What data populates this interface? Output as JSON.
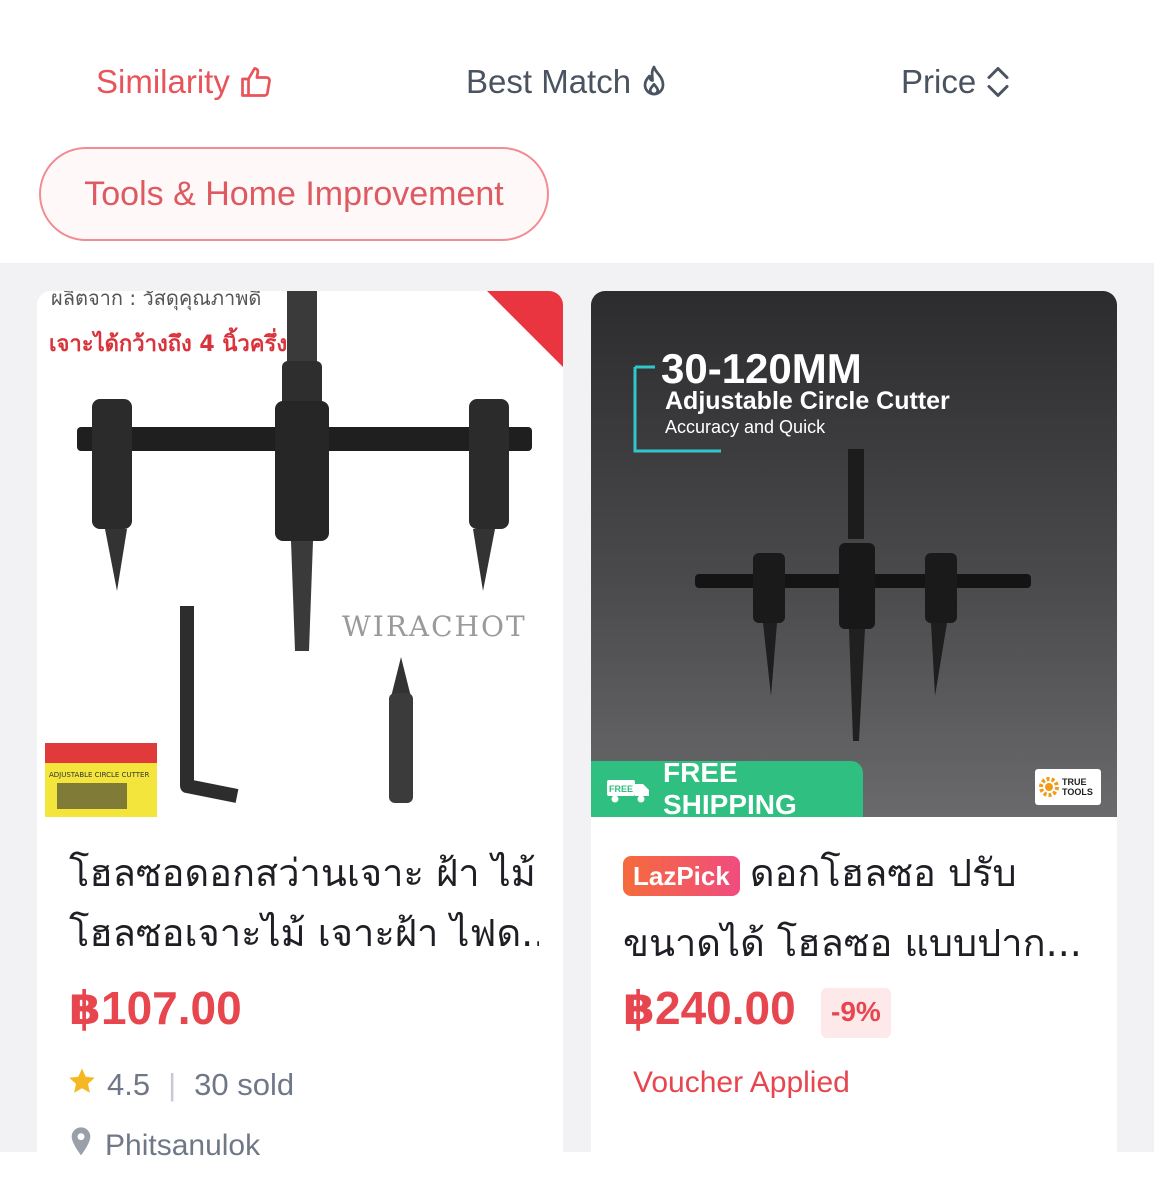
{
  "sort_bar": {
    "tabs": [
      {
        "label": "Similarity",
        "icon": "thumbs-up-icon",
        "active": true
      },
      {
        "label": "Best Match",
        "icon": "flame-icon",
        "active": false
      },
      {
        "label": "Price",
        "icon": "sort-arrows-icon",
        "active": false
      }
    ]
  },
  "category_chip": {
    "label": "Tools & Home Improvement"
  },
  "products": [
    {
      "image": {
        "top_text": "ผลิตจาก : วัสดุคุณภาพดี",
        "headline": "เจาะได้กว้างถึง 4 นิ้วครึ่ง",
        "watermark": "WIRACHOT",
        "package_label": "ADJUSTABLE CIRCLE CUTTER"
      },
      "title_line1": "โฮลซอดอกสว่านเจาะ ฝ้า ไม้",
      "title_line2": "โฮลซอเจาะไม้ เจาะฝ้า ไฟด...",
      "price": "฿107.00",
      "rating": "4.5",
      "sold": "30 sold",
      "location": "Phitsanulok"
    },
    {
      "image": {
        "size": "30-120MM",
        "product": "Adjustable Circle Cutter",
        "tagline": "Accuracy and Quick",
        "shipping_badge": "FREE SHIPPING",
        "truck_label": "FREE",
        "brand_line1": "TRUE",
        "brand_line2": "TOOLS"
      },
      "tag": "LazPick",
      "title_line1": "ดอกโฮลซอ ปรับ",
      "title_line2": "ขนาดได้ โฮลซอ แบบปาก...",
      "price": "฿240.00",
      "discount": "-9%",
      "voucher": "Voucher Applied"
    }
  ],
  "colors": {
    "accent": "#e8545a",
    "price": "#e8464f",
    "muted": "#707888",
    "shipping": "#2fbf80",
    "background": "#f2f2f5"
  }
}
